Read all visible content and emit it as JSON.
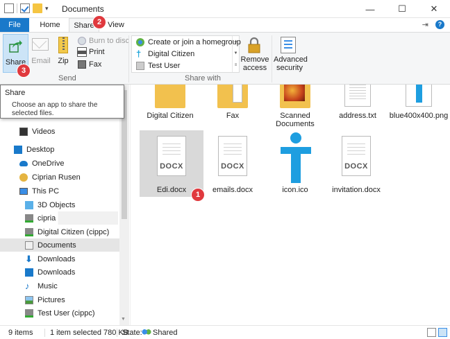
{
  "window": {
    "title": "Documents",
    "minimize": "—",
    "maximize": "☐",
    "close": "✕"
  },
  "tabs": {
    "file": "File",
    "home": "Home",
    "share": "Share",
    "view": "View"
  },
  "ribbon": {
    "send": {
      "group_label": "Send",
      "share": "Share",
      "email": "Email",
      "zip": "Zip",
      "burn": "Burn to disc",
      "print": "Print",
      "fax": "Fax"
    },
    "share_with": {
      "group_label": "Share with",
      "items": [
        "Create or join a homegroup",
        "Digital Citizen",
        "Test User"
      ]
    },
    "remove_access": [
      "Remove",
      "access"
    ],
    "advanced_security": [
      "Advanced",
      "security"
    ]
  },
  "tooltip": {
    "title": "Share",
    "description": "Choose an app to share the selected files."
  },
  "nav": {
    "items": [
      "Videos",
      "Desktop",
      "OneDrive",
      "Ciprian Rusen",
      "This PC",
      "3D Objects",
      "cipria",
      "Digital Citizen (cippc)",
      "Documents",
      "Downloads",
      "Downloads",
      "Music",
      "Pictures",
      "Test User (cippc)"
    ],
    "selected_index": 8
  },
  "content": {
    "top_row": [
      "Digital Citizen",
      "Fax",
      "Scanned Documents",
      "address.txt",
      "blue400x400.png"
    ],
    "files": [
      {
        "name": "Edi.docx",
        "type": "DOCX"
      },
      {
        "name": "emails.docx",
        "type": "DOCX"
      },
      {
        "name": "icon.ico",
        "type": "ico"
      },
      {
        "name": "invitation.docx",
        "type": "DOCX"
      }
    ]
  },
  "badges": [
    "1",
    "2",
    "3"
  ],
  "status": {
    "items": "9 items",
    "selected": "1 item selected  780 KB",
    "state": "State:",
    "shared": "Shared"
  },
  "colors": {
    "accent": "#1979ca",
    "badge": "#e0393e",
    "selected_tile": "#d9d9d9",
    "share_btn_bg": "#cce4f7"
  }
}
